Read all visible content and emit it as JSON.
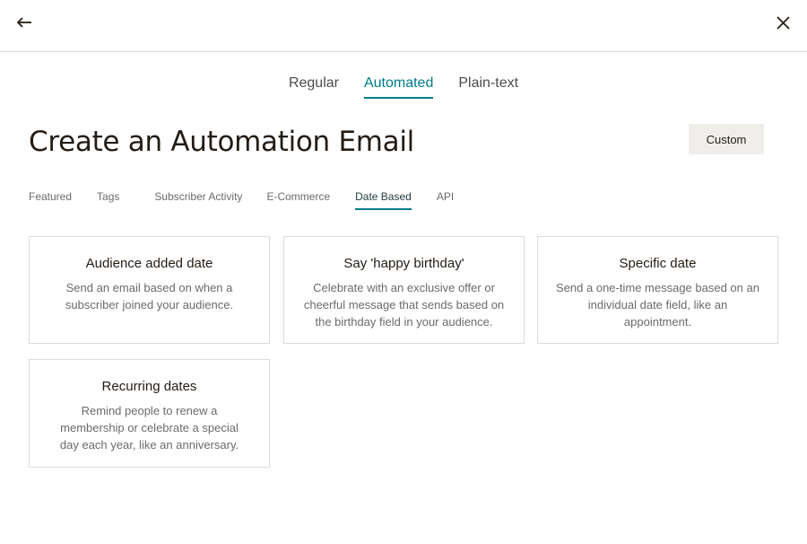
{
  "header": {
    "back_icon": "arrow-left-icon",
    "close_icon": "close-icon"
  },
  "type_tabs": [
    {
      "label": "Regular",
      "active": false
    },
    {
      "label": "Automated",
      "active": true
    },
    {
      "label": "Plain-text",
      "active": false
    }
  ],
  "page": {
    "title": "Create an Automation Email",
    "custom_button": "Custom"
  },
  "category_tabs": [
    {
      "label": "Featured",
      "active": false
    },
    {
      "label": "Tags",
      "active": false
    },
    {
      "label": "Subscriber Activity",
      "active": false
    },
    {
      "label": "E-Commerce",
      "active": false
    },
    {
      "label": "Date Based",
      "active": true
    },
    {
      "label": "API",
      "active": false
    }
  ],
  "cards": [
    {
      "title": "Audience added date",
      "description": "Send an email based on when a subscriber joined your audience."
    },
    {
      "title": "Say 'happy birthday'",
      "description": "Celebrate with an exclusive offer or cheerful message that sends based on the birthday field in your audience."
    },
    {
      "title": "Specific date",
      "description": "Send a one-time message based on an individual date field, like an appointment."
    },
    {
      "title": "Recurring dates",
      "description": "Remind people to renew a membership or celebrate a special day each year, like an anniversary."
    }
  ],
  "colors": {
    "accent": "#007c89",
    "text": "#241c15",
    "muted": "#6b6b6b",
    "button_bg": "#efeeea",
    "border": "#dcdcdc"
  }
}
